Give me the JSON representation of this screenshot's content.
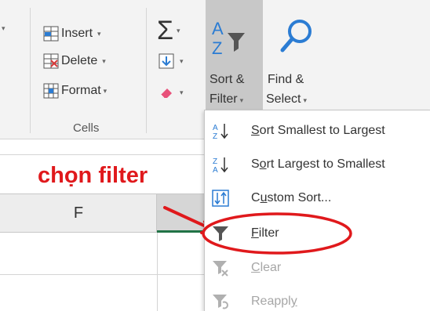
{
  "ribbon": {
    "cells": {
      "insert_label": "Insert",
      "delete_label": "Delete",
      "format_label": "Format",
      "group_label": "Cells"
    },
    "editing": {
      "sort_filter_line1": "Sort &",
      "sort_filter_line2": "Filter",
      "find_select_line1": "Find &",
      "find_select_line2": "Select"
    }
  },
  "sheet": {
    "column_f_label": "F"
  },
  "annotation": {
    "text": "chọn filter",
    "color": "#e0191c"
  },
  "dropdown_menu": {
    "items": [
      {
        "label_pre": "",
        "label_u": "S",
        "label_post": "ort Smallest to Largest",
        "icon": "sort-ascending-icon",
        "enabled": true
      },
      {
        "label_pre": "S",
        "label_u": "o",
        "label_post": "rt Largest to Smallest",
        "icon": "sort-descending-icon",
        "enabled": true
      },
      {
        "label_pre": "C",
        "label_u": "u",
        "label_post": "stom Sort...",
        "icon": "custom-sort-icon",
        "enabled": true
      },
      {
        "label_pre": "",
        "label_u": "F",
        "label_post": "ilter",
        "icon": "funnel-icon",
        "enabled": true
      },
      {
        "label_pre": "",
        "label_u": "C",
        "label_post": "lear",
        "icon": "clear-filter-icon",
        "enabled": false
      },
      {
        "label_pre": "Reappl",
        "label_u": "y",
        "label_post": "",
        "icon": "reapply-filter-icon",
        "enabled": false
      }
    ]
  },
  "colors": {
    "accent": "#217346",
    "highlight_ring": "#e0191c",
    "ribbon_bg": "#f3f3f3"
  }
}
